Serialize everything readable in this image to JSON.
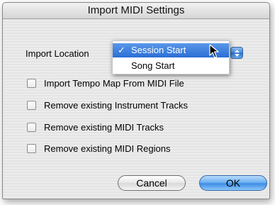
{
  "dialog": {
    "title": "Import MIDI Settings"
  },
  "import_location": {
    "label": "Import Location",
    "options": [
      {
        "label": "Session Start",
        "selected": true,
        "check": "✓"
      },
      {
        "label": "Song Start",
        "selected": false
      }
    ],
    "stepper_icon": "up-down-arrows-icon"
  },
  "checkboxes": [
    {
      "label": "Import Tempo Map From MIDI File",
      "checked": false
    },
    {
      "label": "Remove existing Instrument Tracks",
      "checked": false
    },
    {
      "label": "Remove existing MIDI Tracks",
      "checked": false
    },
    {
      "label": "Remove existing MIDI Regions",
      "checked": false
    }
  ],
  "buttons": {
    "cancel": "Cancel",
    "ok": "OK"
  },
  "colors": {
    "accent": "#2b6ed6",
    "default_button": "#6fb2f2"
  }
}
